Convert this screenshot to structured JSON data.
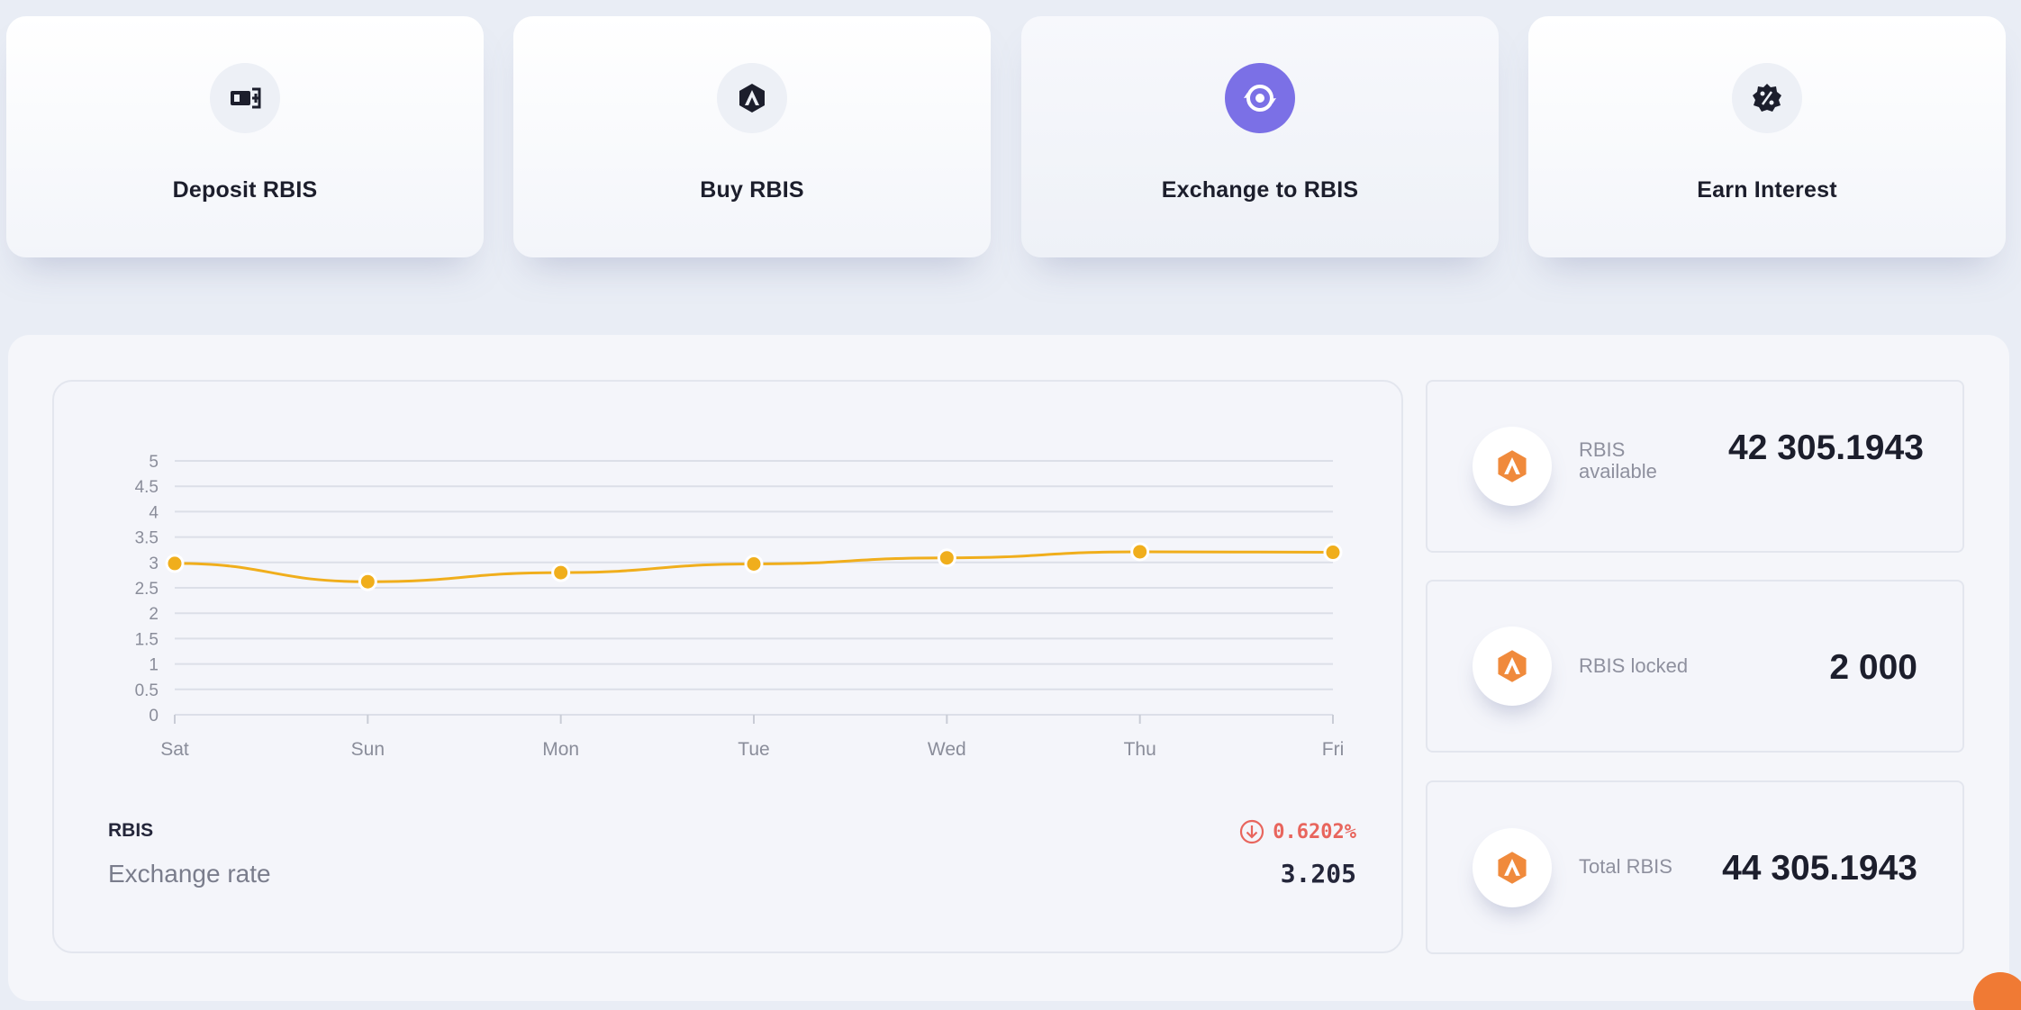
{
  "actions": [
    {
      "label": "Deposit RBIS",
      "icon": "deposit-icon"
    },
    {
      "label": "Buy RBIS",
      "icon": "rbis-logo-icon"
    },
    {
      "label": "Exchange to RBIS",
      "icon": "exchange-icon"
    },
    {
      "label": "Earn Interest",
      "icon": "interest-icon"
    }
  ],
  "colors": {
    "accent": "#7b70e6",
    "line": "#f0ae1c",
    "brand_orange": "#f08a3c",
    "negative": "#e8655d"
  },
  "chart_data": {
    "type": "line",
    "categories": [
      "Sat",
      "Sun",
      "Mon",
      "Tue",
      "Wed",
      "Thu",
      "Fri"
    ],
    "series": [
      {
        "values": [
          2.98,
          2.62,
          2.8,
          2.97,
          3.09,
          3.21,
          3.2
        ]
      }
    ],
    "yticks": [
      "0",
      "0.5",
      "1",
      "1.5",
      "2",
      "2.5",
      "3",
      "3.5",
      "4",
      "4.5",
      "5"
    ],
    "ylim": [
      0,
      5
    ],
    "grid": true
  },
  "rate": {
    "name": "RBIS",
    "label": "Exchange rate",
    "change": "0.6202%",
    "value": "3.205"
  },
  "stats": [
    {
      "label": "RBIS available",
      "value": "42 305.1943"
    },
    {
      "label": "RBIS locked",
      "value": "2 000"
    },
    {
      "label": "Total RBIS",
      "value": "44 305.1943"
    }
  ]
}
